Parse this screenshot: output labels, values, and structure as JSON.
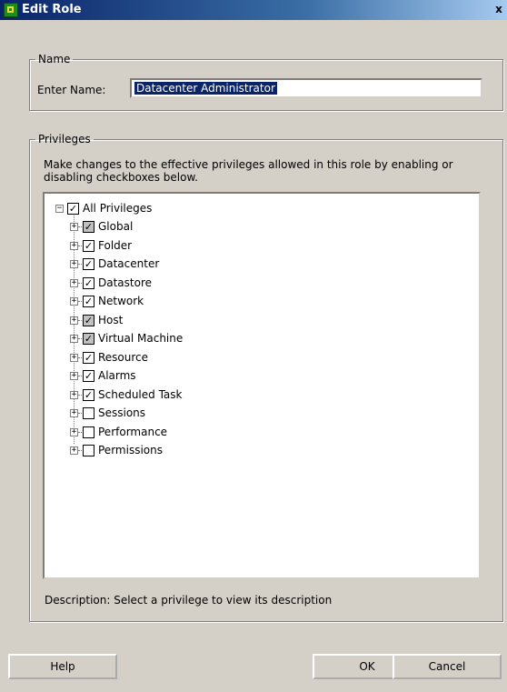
{
  "window": {
    "title": "Edit Role",
    "close_label": "x"
  },
  "name_group": {
    "legend": "Name",
    "label": "Enter Name:",
    "value": "Datacenter Administrator"
  },
  "privileges_group": {
    "legend": "Privileges",
    "instructions": "Make changes to the effective privileges allowed in this role by enabling or disabling checkboxes below.",
    "root": {
      "label": "All Privileges",
      "checked": true
    },
    "items": [
      {
        "label": "Global",
        "checked": true,
        "partial": true
      },
      {
        "label": "Folder",
        "checked": true,
        "partial": false
      },
      {
        "label": "Datacenter",
        "checked": true,
        "partial": false
      },
      {
        "label": "Datastore",
        "checked": true,
        "partial": false
      },
      {
        "label": "Network",
        "checked": true,
        "partial": false
      },
      {
        "label": "Host",
        "checked": true,
        "partial": true
      },
      {
        "label": "Virtual Machine",
        "checked": true,
        "partial": true
      },
      {
        "label": "Resource",
        "checked": true,
        "partial": false
      },
      {
        "label": "Alarms",
        "checked": true,
        "partial": false
      },
      {
        "label": "Scheduled Task",
        "checked": true,
        "partial": false
      },
      {
        "label": "Sessions",
        "checked": false,
        "partial": false
      },
      {
        "label": "Performance",
        "checked": false,
        "partial": false
      },
      {
        "label": "Permissions",
        "checked": false,
        "partial": false
      }
    ],
    "description": "Description:  Select a privilege to view its description"
  },
  "buttons": {
    "help": "Help",
    "ok": "OK",
    "cancel": "Cancel"
  }
}
